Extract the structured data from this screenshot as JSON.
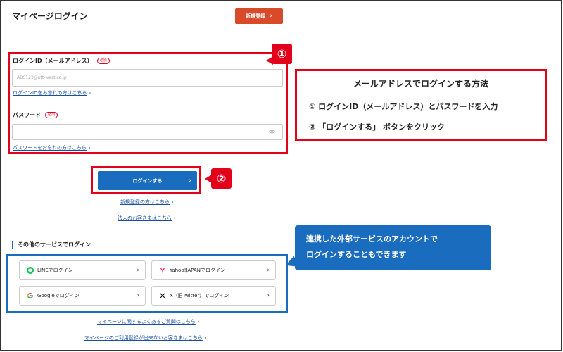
{
  "page": {
    "title": "マイページログイン",
    "register_button": "新規登録"
  },
  "login_form": {
    "badge": "①",
    "id_label": "ログインID（メールアドレス）",
    "id_required": "必須",
    "id_placeholder": "ABC123@ntt-west.co.jp",
    "id_forgot_link": "ログインIDをお忘れの方はこちら",
    "password_label": "パスワード",
    "password_required": "必須",
    "password_forgot_link": "パスワードをお忘れの方はこちら"
  },
  "login_action": {
    "badge": "②",
    "button_label": "ログインする",
    "new_register_link": "新規登録の方はこちら",
    "corporate_link": "法人のお客さまはこちら"
  },
  "instructions": {
    "title": "メールアドレスでログインする方法",
    "step1": "① ログインID（メールアドレス）とパスワードを入力",
    "step2": "② 「ログインする」 ボタンをクリック"
  },
  "other_services": {
    "section_title": "その他のサービスでログイン",
    "line_label": "LINEでログイン",
    "yahoo_label": "Yahoo!JAPANでログイン",
    "google_label": "Googleでログイン",
    "x_label": "X（旧Twitter）でログイン"
  },
  "callout": {
    "line1": "連携した外部サービスのアカウントで",
    "line2": "ログインすることもできます"
  },
  "footer_links": {
    "faq": "マイページに関するよくあるご質問はこちら",
    "cant_register": "マイページのご利用登録が出来ないお客さまはこちら"
  },
  "colors": {
    "highlight_red": "#e2001a",
    "primary_blue": "#1a6cbf",
    "register_orange": "#d94a2b",
    "link_blue": "#1a4fa3"
  }
}
